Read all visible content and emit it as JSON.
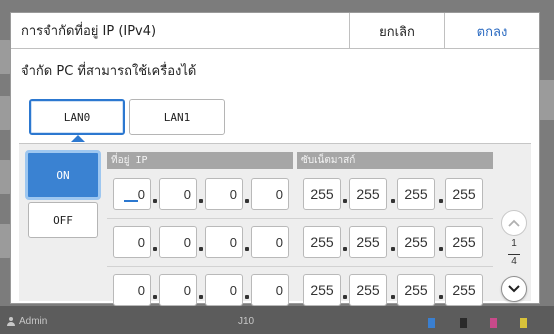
{
  "dialog": {
    "title": "การจำกัดที่อยู่ IP (IPv4)",
    "cancel_label": "ยกเลิก",
    "ok_label": "ตกลง",
    "subtitle": "จำกัด PC ที่สามารถใช้เครื่องได้"
  },
  "lan_tabs": [
    {
      "label": "LAN0",
      "selected": true
    },
    {
      "label": "LAN1",
      "selected": false
    }
  ],
  "toggle": {
    "on_label": "ON",
    "off_label": "OFF",
    "selected": "ON"
  },
  "columns": {
    "ip_header": "ที่อยู่ IP",
    "mask_header": "ซับเน็ตมาสก์"
  },
  "rows": [
    {
      "ip": [
        "0",
        "0",
        "0",
        "0"
      ],
      "mask": [
        "255",
        "255",
        "255",
        "255"
      ]
    },
    {
      "ip": [
        "0",
        "0",
        "0",
        "0"
      ],
      "mask": [
        "255",
        "255",
        "255",
        "255"
      ]
    },
    {
      "ip": [
        "0",
        "0",
        "0",
        "0"
      ],
      "mask": [
        "255",
        "255",
        "255",
        "255"
      ]
    }
  ],
  "pager": {
    "current": "1",
    "total": "4"
  },
  "status_bar": {
    "user": "Admin",
    "counter": "J10"
  },
  "colors": {
    "accent": "#2c78d0",
    "on_button": "#3a82d2",
    "header_gray": "#a6a6a6"
  }
}
